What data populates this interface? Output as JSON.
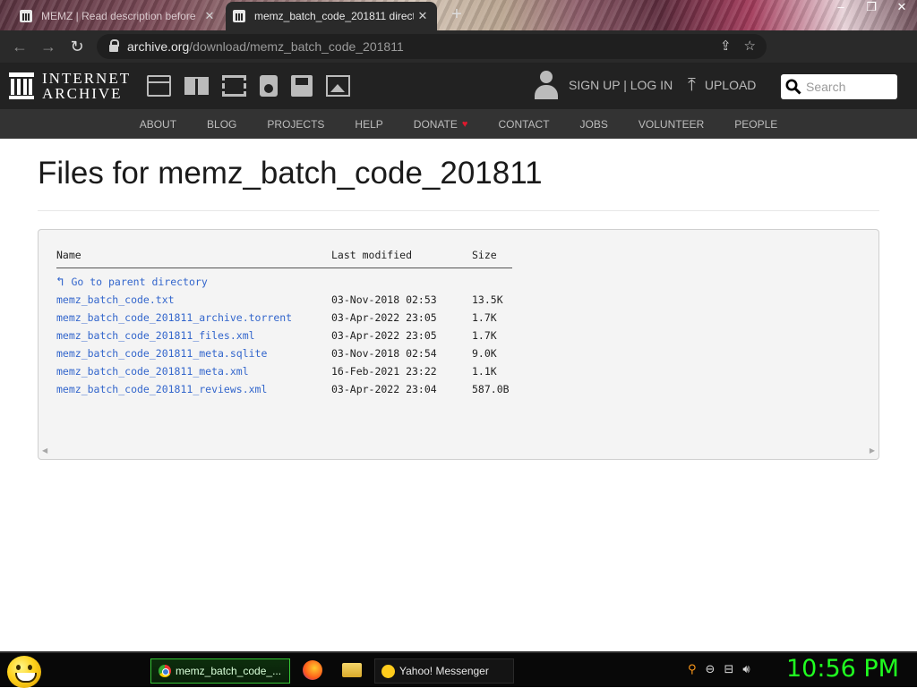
{
  "browser": {
    "tabs": [
      {
        "title": "MEMZ | Read description before",
        "active": false
      },
      {
        "title": "memz_batch_code_201811 direct",
        "active": true
      }
    ],
    "url_host": "archive.org",
    "url_path": "/download/memz_batch_code_201811"
  },
  "ia_header": {
    "logo_line1": "INTERNET",
    "logo_line2": "ARCHIVE",
    "media_icons": [
      "web-icon",
      "texts-icon",
      "video-icon",
      "audio-icon",
      "software-icon",
      "images-icon"
    ],
    "account_label": "SIGN UP | LOG IN",
    "upload_label": "UPLOAD",
    "search_placeholder": "Search"
  },
  "ia_nav": {
    "items": [
      "ABOUT",
      "BLOG",
      "PROJECTS",
      "HELP",
      "DONATE",
      "CONTACT",
      "JOBS",
      "VOLUNTEER",
      "PEOPLE"
    ]
  },
  "page": {
    "title": "Files for memz_batch_code_201811"
  },
  "listing": {
    "headers": [
      "Name",
      "Last modified",
      "Size"
    ],
    "parent_label": "Go to parent directory",
    "files": [
      {
        "name": "memz_batch_code.txt",
        "modified": "03-Nov-2018 02:53",
        "size": "13.5K"
      },
      {
        "name": "memz_batch_code_201811_archive.torrent",
        "modified": "03-Apr-2022 23:05",
        "size": "1.7K"
      },
      {
        "name": "memz_batch_code_201811_files.xml",
        "modified": "03-Apr-2022 23:05",
        "size": "1.7K"
      },
      {
        "name": "memz_batch_code_201811_meta.sqlite",
        "modified": "03-Nov-2018 02:54",
        "size": "9.0K"
      },
      {
        "name": "memz_batch_code_201811_meta.xml",
        "modified": "16-Feb-2021 23:22",
        "size": "1.1K"
      },
      {
        "name": "memz_batch_code_201811_reviews.xml",
        "modified": "03-Apr-2022 23:04",
        "size": "587.0B"
      }
    ]
  },
  "taskbar": {
    "active_task_label": "memz_batch_code_...",
    "messenger_label": "Yahoo! Messenger",
    "clock": "10:56 PM"
  },
  "colors": {
    "ia_header_bg": "#222222",
    "ia_nav_bg": "#333333",
    "link": "#3366cc",
    "donate_heart": "#e0182d",
    "clock": "#20ff20"
  }
}
